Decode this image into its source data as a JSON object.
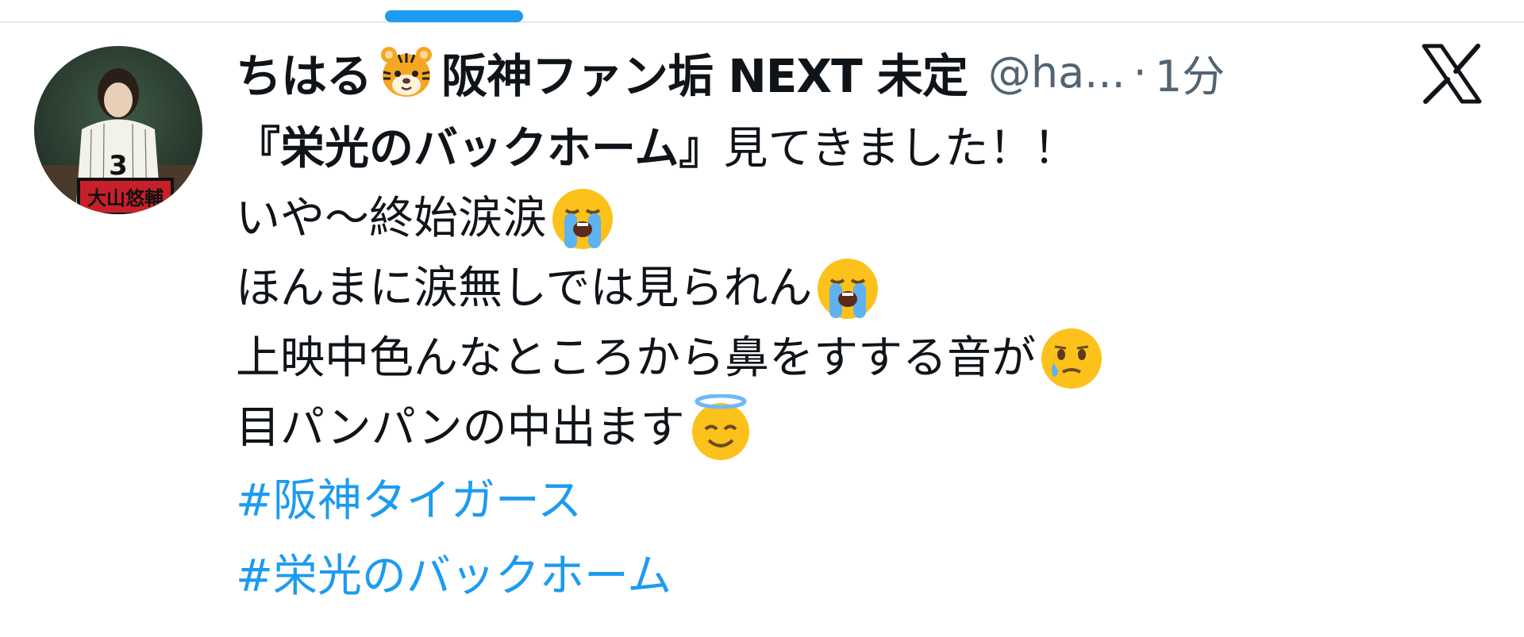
{
  "tweet": {
    "display_name": "ちはる",
    "display_name_tail": "阪神ファン垢 NEXT 未定",
    "handle": "@ha...",
    "separator": "·",
    "time": "1分",
    "lines": [
      {
        "bold": "『栄光のバックホーム』",
        "text": "見てきました！！",
        "emoji": ""
      },
      {
        "bold": "",
        "text": "いや〜終始涙涙",
        "emoji": "loudly-crying-face"
      },
      {
        "bold": "",
        "text": "ほんまに涙無しでは見られん",
        "emoji": "loudly-crying-face"
      },
      {
        "bold": "",
        "text": "上映中色んなところから鼻をすする音が",
        "emoji": "face-holding-back-tears"
      },
      {
        "bold": "",
        "text": "目パンパンの中出ます",
        "emoji": "smiling-face-with-halo"
      }
    ],
    "hashtags": [
      "#阪神タイガース",
      "#栄光のバックホーム"
    ]
  },
  "avatar_jersey_number": "3",
  "avatar_banner_text": "大山悠輔",
  "colors": {
    "link": "#1d9bf0",
    "secondary": "#536471",
    "text": "#0f1419",
    "tab_indicator": "#1d9bf0"
  }
}
